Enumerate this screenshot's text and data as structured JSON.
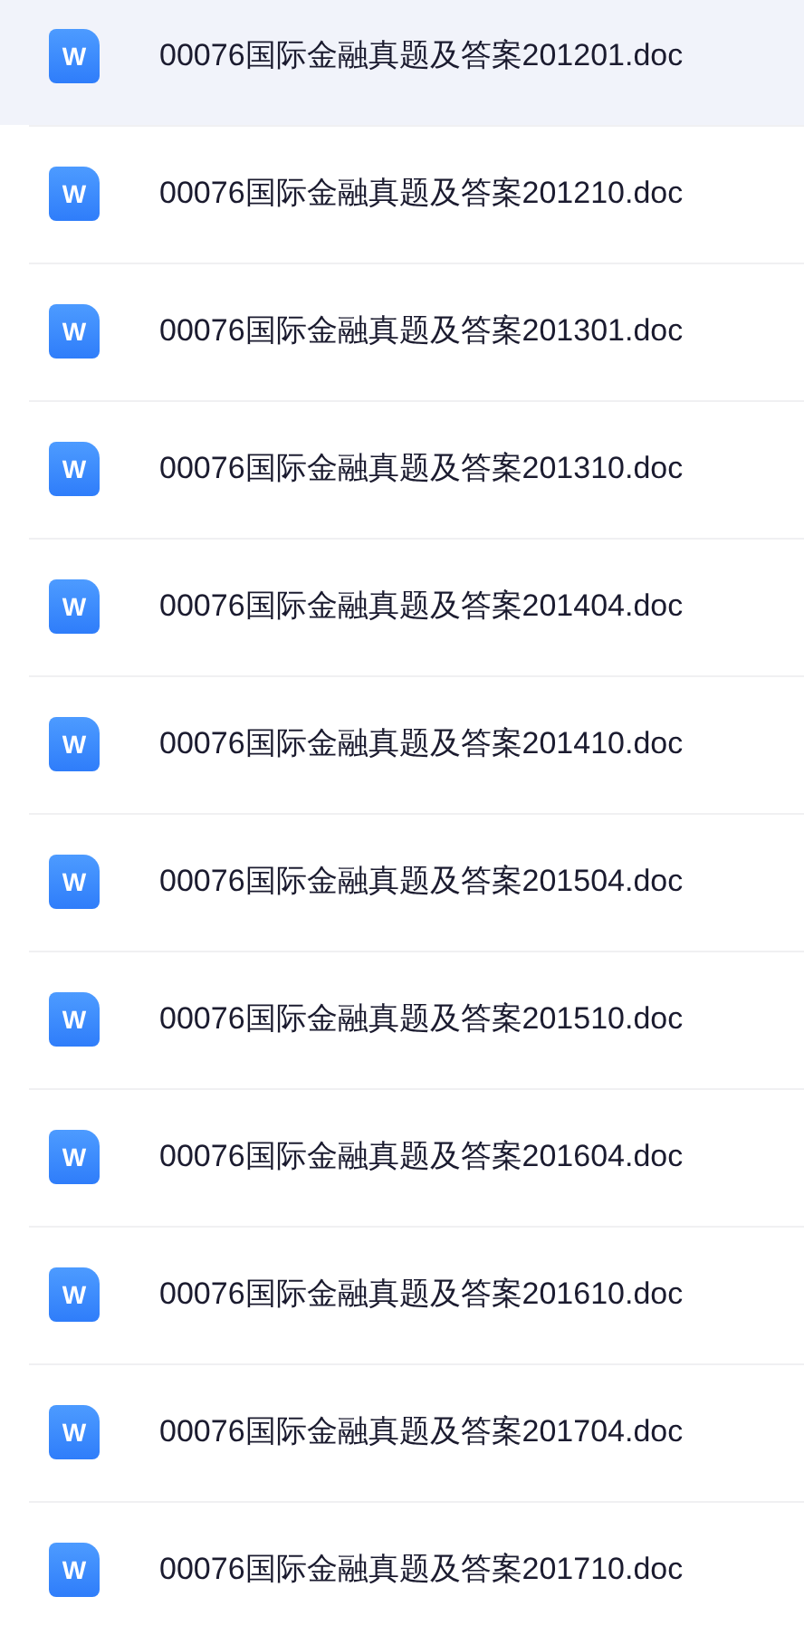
{
  "files": [
    {
      "name": "00076国际金融真题及答案201201.doc",
      "icon_label": "W",
      "selected": true
    },
    {
      "name": "00076国际金融真题及答案201210.doc",
      "icon_label": "W",
      "selected": false
    },
    {
      "name": "00076国际金融真题及答案201301.doc",
      "icon_label": "W",
      "selected": false
    },
    {
      "name": "00076国际金融真题及答案201310.doc",
      "icon_label": "W",
      "selected": false
    },
    {
      "name": "00076国际金融真题及答案201404.doc",
      "icon_label": "W",
      "selected": false
    },
    {
      "name": "00076国际金融真题及答案201410.doc",
      "icon_label": "W",
      "selected": false
    },
    {
      "name": "00076国际金融真题及答案201504.doc",
      "icon_label": "W",
      "selected": false
    },
    {
      "name": "00076国际金融真题及答案201510.doc",
      "icon_label": "W",
      "selected": false
    },
    {
      "name": "00076国际金融真题及答案201604.doc",
      "icon_label": "W",
      "selected": false
    },
    {
      "name": "00076国际金融真题及答案201610.doc",
      "icon_label": "W",
      "selected": false
    },
    {
      "name": "00076国际金融真题及答案201704.doc",
      "icon_label": "W",
      "selected": false
    },
    {
      "name": "00076国际金融真题及答案201710.doc",
      "icon_label": "W",
      "selected": false
    }
  ]
}
